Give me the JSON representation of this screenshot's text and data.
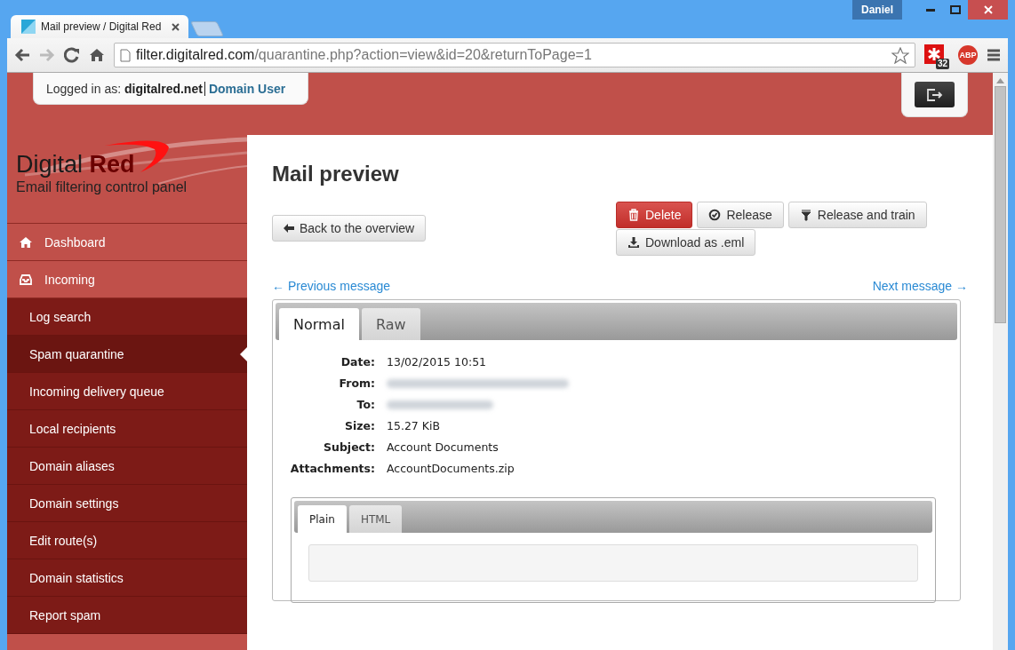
{
  "browser": {
    "user": "Daniel",
    "tab_title": "Mail preview / Digital Red",
    "url_host": "filter.digitalred.com",
    "url_path": "/quarantine.php?action=view&id=20&returnToPage=1",
    "extension_badge": "32",
    "adblock_label": "ABP"
  },
  "header": {
    "logged_in_label": "Logged in as:",
    "domain": "digitalred.net",
    "role": "Domain User"
  },
  "logo": {
    "name_first": "Digital",
    "name_second": "Red",
    "tagline": "Email filtering control panel"
  },
  "sidebar": {
    "items": [
      {
        "label": "Dashboard",
        "selected": false
      },
      {
        "label": "Incoming",
        "selected": false,
        "children": [
          {
            "label": "Log search",
            "selected": false
          },
          {
            "label": "Spam quarantine",
            "selected": true
          },
          {
            "label": "Incoming delivery queue",
            "selected": false
          },
          {
            "label": "Local recipients",
            "selected": false
          },
          {
            "label": "Domain aliases",
            "selected": false
          },
          {
            "label": "Domain settings",
            "selected": false
          },
          {
            "label": "Edit route(s)",
            "selected": false
          },
          {
            "label": "Domain statistics",
            "selected": false
          },
          {
            "label": "Report spam",
            "selected": false
          }
        ]
      }
    ]
  },
  "page_title": "Mail preview",
  "back_button": "Back to the overview",
  "actions": [
    {
      "label": "Delete",
      "kind": "danger"
    },
    {
      "label": "Release",
      "kind": "default"
    },
    {
      "label": "Release and train",
      "kind": "default"
    },
    {
      "label": "Download as .eml",
      "kind": "default"
    }
  ],
  "pager": {
    "previous": "← Previous message",
    "next": "Next message →"
  },
  "tabs": [
    {
      "label": "Normal",
      "selected": true
    },
    {
      "label": "Raw",
      "selected": false
    }
  ],
  "details": [
    {
      "label": "Date:",
      "kind": "text",
      "value": "13/02/2015 10:51"
    },
    {
      "label": "From:",
      "kind": "redacted"
    },
    {
      "label": "To:",
      "kind": "redacted"
    },
    {
      "label": "Size:",
      "kind": "text",
      "value": "15.27 KiB"
    },
    {
      "label": "Subject:",
      "kind": "text",
      "value": "Account Documents"
    },
    {
      "label": "Attachments:",
      "kind": "text",
      "value": "AccountDocuments.zip"
    }
  ],
  "body_tabs": [
    {
      "label": "Plain",
      "selected": true
    },
    {
      "label": "HTML",
      "selected": false
    }
  ]
}
